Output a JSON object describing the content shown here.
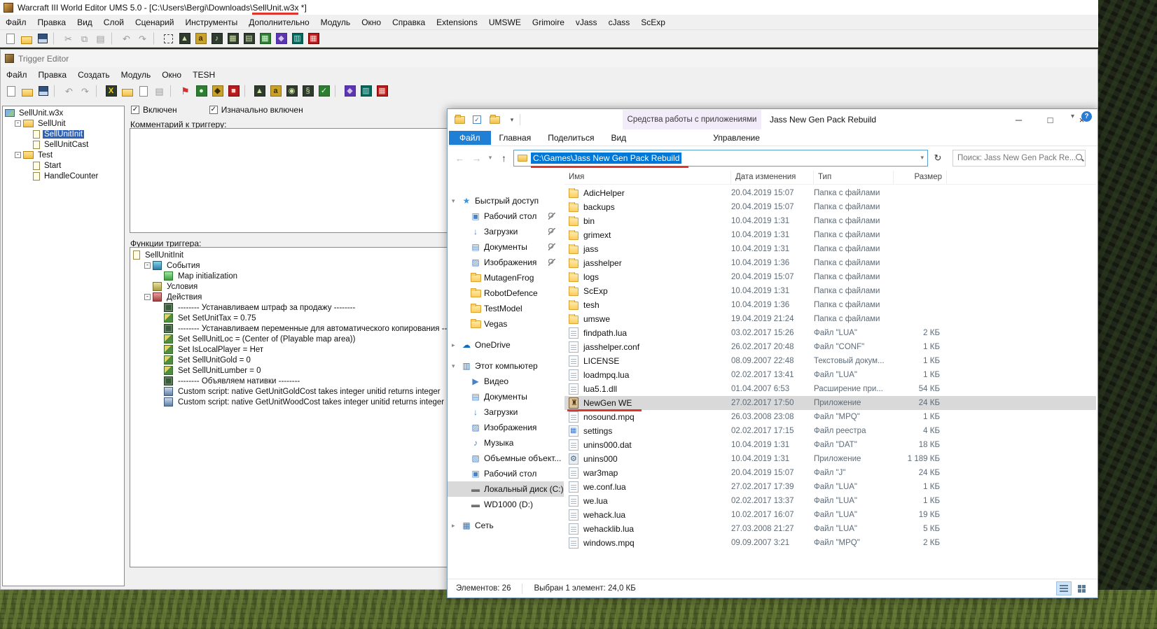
{
  "colors": {
    "annotation_red": "#e0352b",
    "selection_blue": "#0078d7",
    "file_tab_blue": "#1f7fd4",
    "context_tab_bg": "#f2ebfa",
    "folder_yellow": "#fccf5e"
  },
  "we_window": {
    "title_prefix": "Warcraft III World Editor UMS 5.0 - [C:\\Users\\Bergi\\Downloads\\",
    "title_marked": "SellUnit.w3x",
    "title_suffix": " *]",
    "menu": [
      "Файл",
      "Правка",
      "Вид",
      "Слой",
      "Сценарий",
      "Инструменты",
      "Дополнительно",
      "Модуль",
      "Окно",
      "Справка",
      "Extensions",
      "UMSWE",
      "Grimoire",
      "vJass",
      "cJass",
      "ScExp"
    ],
    "toolbar": [
      {
        "dn": "new-map-icon",
        "kind": "page"
      },
      {
        "dn": "open-map-icon",
        "kind": "folder"
      },
      {
        "dn": "save-map-icon",
        "kind": "save"
      },
      {
        "dn": "toolbar-separator",
        "kind": "sep",
        "interactable": false
      },
      {
        "dn": "cut-icon",
        "kind": "gray",
        "glyph": "✂"
      },
      {
        "dn": "copy-icon",
        "kind": "gray",
        "glyph": "⧉"
      },
      {
        "dn": "paste-icon",
        "kind": "gray",
        "glyph": "▤"
      },
      {
        "dn": "toolbar-separator",
        "kind": "sep",
        "interactable": false
      },
      {
        "dn": "undo-icon",
        "kind": "gray",
        "glyph": "↶"
      },
      {
        "dn": "redo-icon",
        "kind": "gray",
        "glyph": "↷"
      },
      {
        "dn": "toolbar-separator",
        "kind": "sep",
        "interactable": false
      },
      {
        "dn": "selection-tool-icon",
        "kind": "sel"
      },
      {
        "dn": "terrain-editor-icon",
        "kind": "dark",
        "glyph": "▲"
      },
      {
        "dn": "text-strings-icon",
        "kind": "gold",
        "glyph": "a"
      },
      {
        "dn": "sound-editor-icon",
        "kind": "dark",
        "glyph": "♪"
      },
      {
        "dn": "object-editor-icon",
        "kind": "dark",
        "glyph": "▦"
      },
      {
        "dn": "campaign-editor-icon",
        "kind": "dark",
        "glyph": "▤"
      },
      {
        "dn": "trigger-editor-icon",
        "kind": "green",
        "glyph": "▦"
      },
      {
        "dn": "ai-editor-icon",
        "kind": "purple",
        "glyph": "◆"
      },
      {
        "dn": "object-manager-icon",
        "kind": "teal",
        "glyph": "▥"
      },
      {
        "dn": "import-manager-icon",
        "kind": "red",
        "glyph": "▦"
      }
    ]
  },
  "trigger_editor": {
    "title": "Trigger Editor",
    "menu": [
      "Файл",
      "Правка",
      "Создать",
      "Модуль",
      "Окно",
      "TESH"
    ],
    "toolbar": [
      {
        "dn": "new-icon",
        "kind": "page"
      },
      {
        "dn": "open-icon",
        "kind": "folder"
      },
      {
        "dn": "save-icon",
        "kind": "save"
      },
      {
        "dn": "toolbar-separator",
        "kind": "sep",
        "interactable": false
      },
      {
        "dn": "undo-icon",
        "kind": "gray",
        "glyph": "↶"
      },
      {
        "dn": "redo-icon",
        "kind": "gray",
        "glyph": "↷"
      },
      {
        "dn": "toolbar-separator",
        "kind": "sep",
        "interactable": false
      },
      {
        "dn": "delete-icon",
        "kind": "x",
        "glyph": "X"
      },
      {
        "dn": "new-category-icon",
        "kind": "folder"
      },
      {
        "dn": "new-trigger-icon",
        "kind": "page"
      },
      {
        "dn": "new-comment-icon",
        "kind": "gray",
        "glyph": "▤"
      },
      {
        "dn": "toolbar-separator",
        "kind": "sep",
        "interactable": false
      },
      {
        "dn": "trigger-flag-icon",
        "kind": "flag",
        "glyph": "⚑"
      },
      {
        "dn": "new-event-icon",
        "kind": "green",
        "glyph": "●"
      },
      {
        "dn": "new-condition-icon",
        "kind": "gold",
        "glyph": "◆"
      },
      {
        "dn": "new-action-icon",
        "kind": "red",
        "glyph": "■"
      },
      {
        "dn": "toolbar-separator",
        "kind": "sep",
        "interactable": false
      },
      {
        "dn": "run-icon",
        "kind": "dark",
        "glyph": "▲"
      },
      {
        "dn": "variables-icon",
        "kind": "gold",
        "glyph": "a"
      },
      {
        "dn": "find-icon",
        "kind": "dark",
        "glyph": "◉"
      },
      {
        "dn": "convert-script-icon",
        "kind": "dark",
        "glyph": "§"
      },
      {
        "dn": "syntax-check-icon",
        "kind": "green",
        "glyph": "✓"
      },
      {
        "dn": "toolbar-separator",
        "kind": "sep",
        "interactable": false
      },
      {
        "dn": "module-a-icon",
        "kind": "purple",
        "glyph": "◆"
      },
      {
        "dn": "module-b-icon",
        "kind": "teal",
        "glyph": "▥"
      },
      {
        "dn": "module-c-icon",
        "kind": "red",
        "glyph": "▦"
      }
    ],
    "check_glyph": "✓",
    "enabled_checkbox": "Включен",
    "initially_on_checkbox": "Изначально включен",
    "comment_label": "Комментарий к триггеру:",
    "comment_text": "",
    "functions_label": "Функции триггера:",
    "tree": [
      {
        "dn": "tree-item-sellunit-w3x",
        "kind": "map",
        "depth": 0,
        "label": "SellUnit.w3x"
      },
      {
        "dn": "tree-folder-sellunit",
        "kind": "cat",
        "depth": 1,
        "expander": "-",
        "label": "SellUnit"
      },
      {
        "dn": "tree-item-sellunitinit",
        "kind": "trig",
        "depth": 2,
        "label": "SellUnitInit",
        "selected": true
      },
      {
        "dn": "tree-item-sellunitcast",
        "kind": "trig",
        "depth": 2,
        "label": "SellUnitCast"
      },
      {
        "dn": "tree-folder-test",
        "kind": "cat",
        "depth": 1,
        "expander": "-",
        "label": "Test"
      },
      {
        "dn": "tree-item-start",
        "kind": "trig",
        "depth": 2,
        "label": "Start"
      },
      {
        "dn": "tree-item-handlecounter",
        "kind": "trig",
        "depth": 2,
        "label": "HandleCounter"
      }
    ],
    "functions": [
      {
        "dn": "func-trigger-root",
        "kind": "trigroot",
        "depth": 0,
        "label": "SellUnitInit"
      },
      {
        "dn": "func-events",
        "kind": "events",
        "depth": 1,
        "expander": "-",
        "label": "События"
      },
      {
        "dn": "func-event-map-init",
        "kind": "event",
        "depth": 2,
        "label": "Map initialization"
      },
      {
        "dn": "func-conditions",
        "kind": "conditions",
        "depth": 1,
        "label": "Условия"
      },
      {
        "dn": "func-actions",
        "kind": "actions",
        "depth": 1,
        "expander": "-",
        "label": "Действия"
      },
      {
        "dn": "func-comment-1",
        "kind": "comment",
        "depth": 2,
        "label": "-------- Устанавливаем штраф за продажу --------"
      },
      {
        "dn": "func-set-setunittax",
        "kind": "set",
        "depth": 2,
        "label": "Set SetUnitTax = 0.75"
      },
      {
        "dn": "func-comment-2",
        "kind": "comment",
        "depth": 2,
        "label": "-------- Устанавливаем переменные для автоматического копирования --------"
      },
      {
        "dn": "func-set-sellunitloc",
        "kind": "set",
        "depth": 2,
        "label": "Set SellUnitLoc = (Center of (Playable map area))"
      },
      {
        "dn": "func-set-islocalplayer",
        "kind": "set",
        "depth": 2,
        "label": "Set IsLocalPlayer = Нет"
      },
      {
        "dn": "func-set-sellunitgold",
        "kind": "set",
        "depth": 2,
        "label": "Set SellUnitGold = 0"
      },
      {
        "dn": "func-set-sellunitlumber",
        "kind": "set",
        "depth": 2,
        "label": "Set SellUnitLumber = 0"
      },
      {
        "dn": "func-comment-3",
        "kind": "comment",
        "depth": 2,
        "label": "-------- Объявляем нативки --------"
      },
      {
        "dn": "func-script-goldcost",
        "kind": "script",
        "depth": 2,
        "label": "Custom script:   native GetUnitGoldCost takes integer unitid returns integer"
      },
      {
        "dn": "func-script-woodcost",
        "kind": "script",
        "depth": 2,
        "label": "Custom script:   native GetUnitWoodCost takes integer unitid returns integer"
      }
    ]
  },
  "explorer": {
    "title": "Jass New Gen Pack Rebuild",
    "context_header": "Средства работы с приложениями",
    "qat": [
      {
        "dn": "explorer-window-icon",
        "kind": "folder",
        "interactable": false
      },
      {
        "dn": "qat-properties-icon",
        "kind": "qcheck",
        "glyph": "✓"
      },
      {
        "dn": "qat-new-folder-icon",
        "kind": "folder"
      },
      {
        "dn": "qat-customize-icon",
        "kind": "plain",
        "glyph": "▾"
      }
    ],
    "controls": {
      "minimize_glyph": "─",
      "maximize_glyph": "□",
      "close_glyph": "×"
    },
    "tabs": [
      {
        "dn": "tab-file",
        "label": "Файл",
        "kind": "file"
      },
      {
        "dn": "tab-home",
        "label": "Главная"
      },
      {
        "dn": "tab-share",
        "label": "Поделиться"
      },
      {
        "dn": "tab-view",
        "label": "Вид"
      },
      {
        "dn": "tab-manage",
        "label": "Управление",
        "kind": "context"
      }
    ],
    "ribbon_collapse_glyph": "▾",
    "help_glyph": "?",
    "nav": {
      "back": "←",
      "forward": "→",
      "dropdown": "▾",
      "up": "↑",
      "addr_dropdown": "▾",
      "refresh": "↻"
    },
    "address": "C:\\Games\\Jass New Gen Pack Rebuild",
    "search_text": "Поиск: Jass New Gen Pack Re...",
    "columns": [
      "Имя",
      "Дата изменения",
      "Тип",
      "Размер"
    ],
    "sidebar": [
      {
        "dn": "sidebar-item-quick-access",
        "kind": "quickaccess",
        "depth": 0,
        "expander": "▾",
        "glyph": "★",
        "label": "Быстрый доступ"
      },
      {
        "dn": "sidebar-item-desktop",
        "kind": "desktop",
        "depth": 1,
        "glyph": "▣",
        "label": "Рабочий стол",
        "pin": true
      },
      {
        "dn": "sidebar-item-downloads",
        "kind": "downloads",
        "depth": 1,
        "glyph": "↓",
        "label": "Загрузки",
        "pin": true
      },
      {
        "dn": "sidebar-item-documents",
        "kind": "documents",
        "depth": 1,
        "glyph": "▤",
        "label": "Документы",
        "pin": true
      },
      {
        "dn": "sidebar-item-pictures",
        "kind": "pictures",
        "depth": 1,
        "glyph": "▨",
        "label": "Изображения",
        "pin": true
      },
      {
        "dn": "sidebar-item-mutagenfrog",
        "kind": "folder",
        "depth": 1,
        "label": "MutagenFrog"
      },
      {
        "dn": "sidebar-item-robotdefence",
        "kind": "folder",
        "depth": 1,
        "label": "RobotDefence"
      },
      {
        "dn": "sidebar-item-testmodel",
        "kind": "folder",
        "depth": 1,
        "label": "TestModel"
      },
      {
        "dn": "sidebar-item-vegas",
        "kind": "folder",
        "depth": 1,
        "label": "Vegas"
      },
      {
        "dn": "sidebar-item-onedrive",
        "kind": "onedrive",
        "depth": 0,
        "expander": "▸",
        "glyph": "☁",
        "label": "OneDrive"
      },
      {
        "dn": "sidebar-item-this-pc",
        "kind": "computer",
        "depth": 0,
        "expander": "▾",
        "glyph": "▥",
        "label": "Этот компьютер"
      },
      {
        "dn": "sidebar-item-videos",
        "kind": "videos",
        "depth": 1,
        "glyph": "▶",
        "label": "Видео"
      },
      {
        "dn": "sidebar-item-documents-2",
        "kind": "documents",
        "depth": 1,
        "glyph": "▤",
        "label": "Документы"
      },
      {
        "dn": "sidebar-item-downloads-2",
        "kind": "downloads",
        "depth": 1,
        "glyph": "↓",
        "label": "Загрузки"
      },
      {
        "dn": "sidebar-item-pictures-2",
        "kind": "pictures",
        "depth": 1,
        "glyph": "▨",
        "label": "Изображения"
      },
      {
        "dn": "sidebar-item-music",
        "kind": "music",
        "depth": 1,
        "glyph": "♪",
        "label": "Музыка"
      },
      {
        "dn": "sidebar-item-3d-objects",
        "kind": "objects3d",
        "depth": 1,
        "glyph": "▧",
        "label": "Объемные объект..."
      },
      {
        "dn": "sidebar-item-desktop-2",
        "kind": "desktop",
        "depth": 1,
        "glyph": "▣",
        "label": "Рабочий стол"
      },
      {
        "dn": "sidebar-item-disk-c",
        "kind": "disk",
        "depth": 1,
        "glyph": "▬",
        "label": "Локальный диск (C:)",
        "selected": true
      },
      {
        "dn": "sidebar-item-disk-d",
        "kind": "disk2",
        "depth": 1,
        "glyph": "▬",
        "label": "WD1000 (D:)"
      },
      {
        "dn": "sidebar-item-network",
        "kind": "network",
        "depth": 0,
        "expander": "▸",
        "glyph": "▦",
        "label": "Сеть"
      }
    ],
    "files": [
      {
        "dn": "file-row-adichelper",
        "kind": "folder",
        "name": "AdicHelper",
        "date": "20.04.2019 15:07",
        "type": "Папка с файлами",
        "size": ""
      },
      {
        "dn": "file-row-backups",
        "kind": "folder",
        "name": "backups",
        "date": "20.04.2019 15:07",
        "type": "Папка с файлами",
        "size": ""
      },
      {
        "dn": "file-row-bin",
        "kind": "folder",
        "name": "bin",
        "date": "10.04.2019 1:31",
        "type": "Папка с файлами",
        "size": ""
      },
      {
        "dn": "file-row-grimext",
        "kind": "folder",
        "name": "grimext",
        "date": "10.04.2019 1:31",
        "type": "Папка с файлами",
        "size": ""
      },
      {
        "dn": "file-row-jass",
        "kind": "folder",
        "name": "jass",
        "date": "10.04.2019 1:31",
        "type": "Папка с файлами",
        "size": ""
      },
      {
        "dn": "file-row-jasshelper",
        "kind": "folder",
        "name": "jasshelper",
        "date": "10.04.2019 1:36",
        "type": "Папка с файлами",
        "size": ""
      },
      {
        "dn": "file-row-logs",
        "kind": "folder",
        "name": "logs",
        "date": "20.04.2019 15:07",
        "type": "Папка с файлами",
        "size": ""
      },
      {
        "dn": "file-row-scexp",
        "kind": "folder",
        "name": "ScExp",
        "date": "10.04.2019 1:31",
        "type": "Папка с файлами",
        "size": ""
      },
      {
        "dn": "file-row-tesh",
        "kind": "folder",
        "name": "tesh",
        "date": "10.04.2019 1:36",
        "type": "Папка с файлами",
        "size": ""
      },
      {
        "dn": "file-row-umswe",
        "kind": "folder",
        "name": "umswe",
        "date": "19.04.2019 21:24",
        "type": "Папка с файлами",
        "size": ""
      },
      {
        "dn": "file-row-findpath-lua",
        "kind": "file",
        "name": "findpath.lua",
        "date": "03.02.2017 15:26",
        "type": "Файл \"LUA\"",
        "size": "2 КБ"
      },
      {
        "dn": "file-row-jasshelper-conf",
        "kind": "file",
        "name": "jasshelper.conf",
        "date": "26.02.2017 20:48",
        "type": "Файл \"CONF\"",
        "size": "1 КБ"
      },
      {
        "dn": "file-row-license",
        "kind": "file",
        "name": "LICENSE",
        "date": "08.09.2007 22:48",
        "type": "Текстовый докум...",
        "size": "1 КБ"
      },
      {
        "dn": "file-row-loadmpq-lua",
        "kind": "file",
        "name": "loadmpq.lua",
        "date": "02.02.2017 13:41",
        "type": "Файл \"LUA\"",
        "size": "1 КБ"
      },
      {
        "dn": "file-row-lua5-1-dll",
        "kind": "file",
        "name": "lua5.1.dll",
        "date": "01.04.2007 6:53",
        "type": "Расширение при...",
        "size": "54 КБ"
      },
      {
        "dn": "file-row-newgen-we",
        "kind": "app",
        "name": "NewGen WE",
        "date": "27.02.2017 17:50",
        "type": "Приложение",
        "size": "24 КБ",
        "selected": true,
        "underline": true
      },
      {
        "dn": "file-row-nosound-mpq",
        "kind": "file",
        "name": "nosound.mpq",
        "date": "26.03.2008 23:08",
        "type": "Файл \"MPQ\"",
        "size": "1 КБ"
      },
      {
        "dn": "file-row-settings",
        "kind": "registry",
        "name": "settings",
        "date": "02.02.2017 17:15",
        "type": "Файл реестра",
        "size": "4 КБ"
      },
      {
        "dn": "file-row-unins000-dat",
        "kind": "file",
        "name": "unins000.dat",
        "date": "10.04.2019 1:31",
        "type": "Файл \"DAT\"",
        "size": "18 КБ"
      },
      {
        "dn": "file-row-unins000",
        "kind": "app2",
        "name": "unins000",
        "date": "10.04.2019 1:31",
        "type": "Приложение",
        "size": "1 189 КБ"
      },
      {
        "dn": "file-row-war3map",
        "kind": "file",
        "name": "war3map",
        "date": "20.04.2019 15:07",
        "type": "Файл \"J\"",
        "size": "24 КБ"
      },
      {
        "dn": "file-row-we-conf-lua",
        "kind": "file",
        "name": "we.conf.lua",
        "date": "27.02.2017 17:39",
        "type": "Файл \"LUA\"",
        "size": "1 КБ"
      },
      {
        "dn": "file-row-we-lua",
        "kind": "file",
        "name": "we.lua",
        "date": "02.02.2017 13:37",
        "type": "Файл \"LUA\"",
        "size": "1 КБ"
      },
      {
        "dn": "file-row-wehack-lua",
        "kind": "file",
        "name": "wehack.lua",
        "date": "10.02.2017 16:07",
        "type": "Файл \"LUA\"",
        "size": "19 КБ"
      },
      {
        "dn": "file-row-wehacklib-lua",
        "kind": "file",
        "name": "wehacklib.lua",
        "date": "27.03.2008 21:27",
        "type": "Файл \"LUA\"",
        "size": "5 КБ"
      },
      {
        "dn": "file-row-windows-mpq",
        "kind": "file",
        "name": "windows.mpq",
        "date": "09.09.2007 3:21",
        "type": "Файл \"MPQ\"",
        "size": "2 КБ"
      }
    ],
    "status_items": "Элементов: 26",
    "status_selected": "Выбран 1 элемент: 24,0 КБ"
  }
}
